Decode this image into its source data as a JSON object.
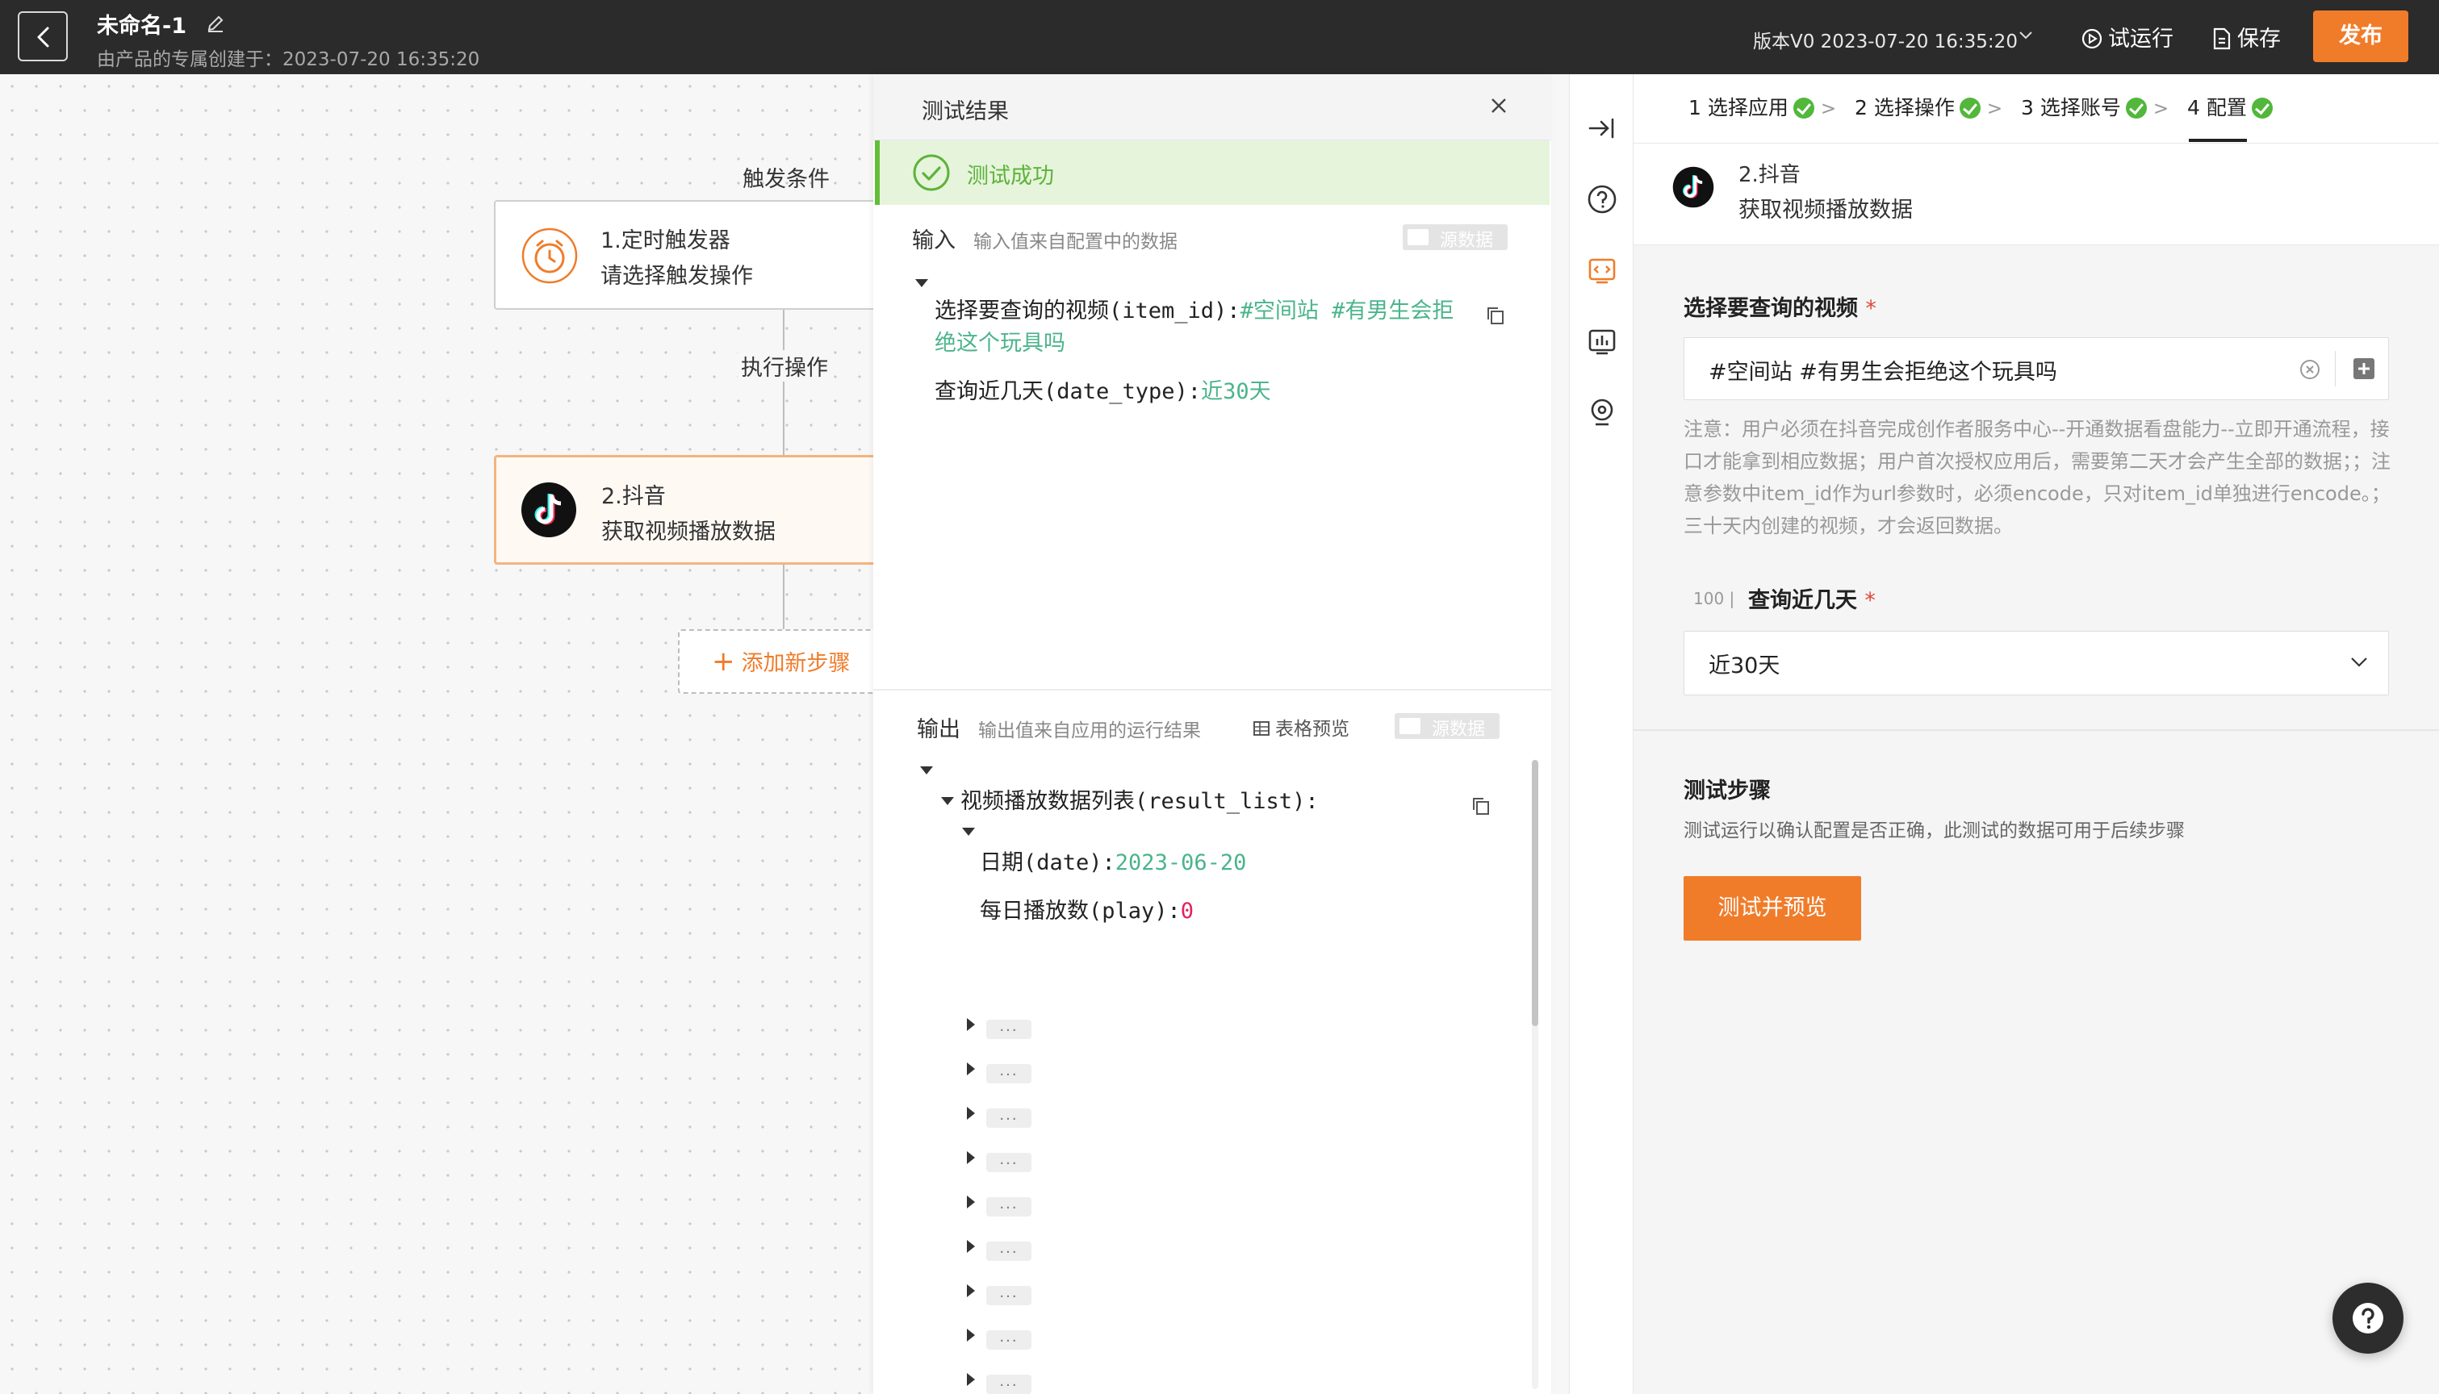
{
  "topbar": {
    "title": "未命名-1",
    "subtitle": "由产品的专属创建于：2023-07-20 16:35:20",
    "version": "版本V0 2023-07-20 16:35:20",
    "run_label": "试运行",
    "save_label": "保存",
    "publish_label": "发布"
  },
  "flow": {
    "trigger_label": "触发条件",
    "action_label": "执行操作",
    "node1_title": "1.定时触发器",
    "node1_desc": "请选择触发操作",
    "node2_title": "2.抖音",
    "node2_desc": "获取视频播放数据",
    "add_step_label": "添加新步骤",
    "add_step_plus": "+"
  },
  "result": {
    "title": "测试结果",
    "success": "测试成功",
    "input_title": "输入",
    "input_hint": "输入值来自配置中的数据",
    "raw_toggle": "源数据",
    "input_items": [
      {
        "key": "选择要查询的视频(item_id):",
        "value_line1": "#空间站 #有男生会拒",
        "value_line2": "绝这个玩具吗"
      },
      {
        "key": "查询近几天(date_type):",
        "value": "近30天"
      }
    ],
    "output_title": "输出",
    "output_hint": "输出值来自应用的运行结果",
    "table_preview": "表格预览",
    "output_list_key": "视频播放数据列表(result_list):",
    "output_items": [
      {
        "key": "日期(date):",
        "value": "2023-06-20"
      },
      {
        "key": "每日播放数(play):",
        "value": "0"
      }
    ],
    "collapsed_label": "..."
  },
  "config": {
    "steps": [
      {
        "label": "1 选择应用"
      },
      {
        "label": "2 选择操作"
      },
      {
        "label": "3 选择账号"
      },
      {
        "label": "4 配置"
      }
    ],
    "app_name": "2.抖音",
    "app_action": "获取视频播放数据",
    "video_label": "选择要查询的视频",
    "video_value": "#空间站 #有男生会拒绝这个玩具吗",
    "note": "注意：用户必须在抖音完成创作者服务中心--开通数据看盘能力--立即开通流程，接口才能拿到相应数据；用户首次授权应用后，需要第二天才会产生全部的数据；；注意参数中item_id作为url参数时，必须encode，只对item_id单独进行encode。；三十天内创建的视频，才会返回数据。",
    "days_badge": "100 |",
    "days_label": "查询近几天",
    "days_value": "近30天",
    "required_mark": "*",
    "test_title": "测试步骤",
    "test_desc": "测试运行以确认配置是否正确，此测试的数据可用于后续步骤",
    "test_button": "测试并预览"
  },
  "colors": {
    "accent": "#f07c2a",
    "success": "#52b73b",
    "topbar": "#2b2b2b",
    "value_green": "#4bb48c"
  }
}
